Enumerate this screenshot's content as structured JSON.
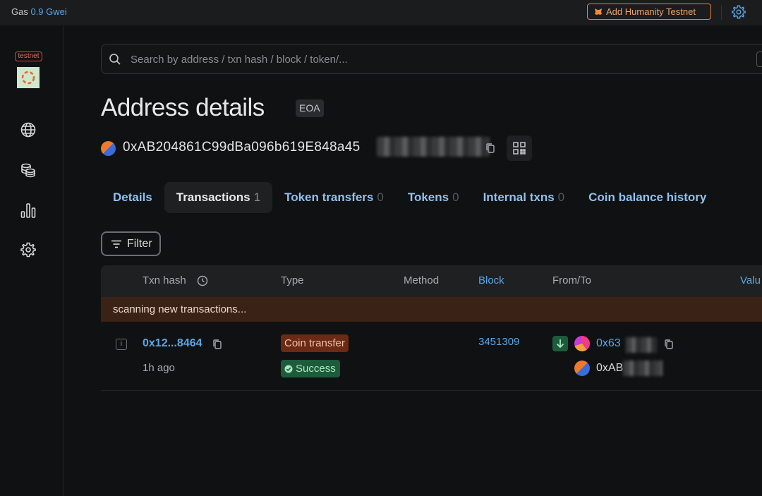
{
  "topbar": {
    "gas_label": "Gas",
    "gas_value": "0.9 Gwei",
    "add_network_label": "Add Humanity Testnet"
  },
  "sidebar": {
    "badge": "testnet",
    "items": [
      {
        "icon": "globe-icon"
      },
      {
        "icon": "coins-icon"
      },
      {
        "icon": "bar-chart-icon"
      },
      {
        "icon": "gear-icon"
      }
    ]
  },
  "search": {
    "placeholder": "Search by address / txn hash / block / token/..."
  },
  "page": {
    "title": "Address details",
    "badge": "EOA",
    "address": "0xAB204861C99dBa096b619E848a45"
  },
  "tabs": [
    {
      "label": "Details",
      "count": ""
    },
    {
      "label": "Transactions",
      "count": "1"
    },
    {
      "label": "Token transfers",
      "count": "0"
    },
    {
      "label": "Tokens",
      "count": "0"
    },
    {
      "label": "Internal txns",
      "count": "0"
    },
    {
      "label": "Coin balance history",
      "count": ""
    }
  ],
  "filter_label": "Filter",
  "table": {
    "columns": [
      "Txn hash",
      "Type",
      "Method",
      "Block",
      "From/To",
      "Valu"
    ],
    "scanning": "scanning new transactions...",
    "rows": [
      {
        "hash": "0x12...8464",
        "age": "1h ago",
        "type": "Coin transfer",
        "status": "Success",
        "block": "3451309",
        "from": "0x63",
        "to": "0xAB"
      }
    ]
  },
  "colors": {
    "accent": "#5aa7e8",
    "background": "#101112",
    "scan_bar": "#3b2217",
    "success": "#1d5b3a",
    "type_badge": "#6b2a16"
  }
}
